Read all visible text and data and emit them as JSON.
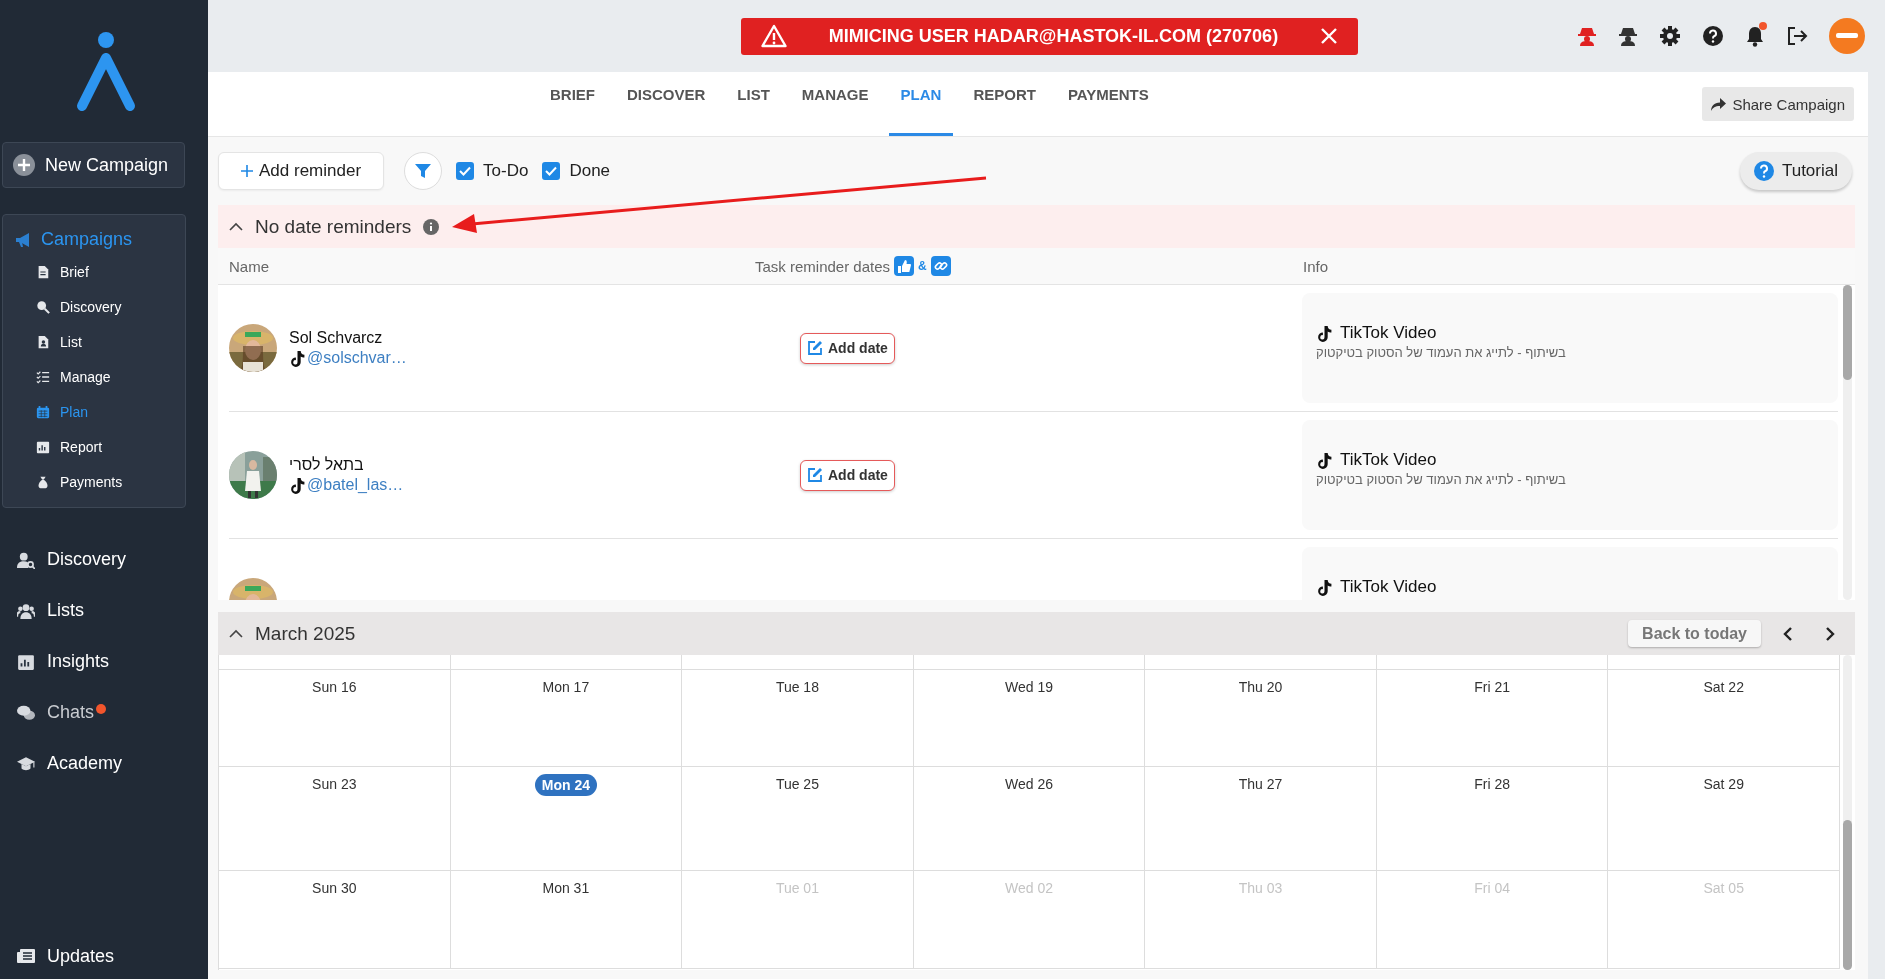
{
  "sidebar": {
    "new_campaign": "New Campaign",
    "campaigns": {
      "label": "Campaigns",
      "items": [
        {
          "label": "Brief",
          "selected": false
        },
        {
          "label": "Discovery",
          "selected": false
        },
        {
          "label": "List",
          "selected": false
        },
        {
          "label": "Manage",
          "selected": false
        },
        {
          "label": "Plan",
          "selected": true
        },
        {
          "label": "Report",
          "selected": false
        },
        {
          "label": "Payments",
          "selected": false
        }
      ]
    },
    "nav": [
      {
        "label": "Discovery",
        "unread": false
      },
      {
        "label": "Lists",
        "unread": false
      },
      {
        "label": "Insights",
        "unread": false
      },
      {
        "label": "Chats",
        "unread": true
      },
      {
        "label": "Academy",
        "unread": false
      }
    ],
    "updates": "Updates"
  },
  "banner": {
    "text": "MIMICING USER HADAR@HASTOK-IL.COM (270706)"
  },
  "tabs": [
    {
      "label": "BRIEF",
      "selected": false
    },
    {
      "label": "DISCOVER",
      "selected": false
    },
    {
      "label": "LIST",
      "selected": false
    },
    {
      "label": "MANAGE",
      "selected": false
    },
    {
      "label": "PLAN",
      "selected": true
    },
    {
      "label": "REPORT",
      "selected": false
    },
    {
      "label": "PAYMENTS",
      "selected": false
    }
  ],
  "share_button": "Share Campaign",
  "toolbar": {
    "add_reminder": "Add reminder",
    "filters": [
      {
        "label": "To-Do",
        "checked": true
      },
      {
        "label": "Done",
        "checked": true
      }
    ],
    "tutorial": "Tutorial"
  },
  "no_date_reminders": {
    "title": "No date reminders",
    "expanded": true,
    "columns": [
      "Name",
      "Task reminder dates",
      "Info"
    ],
    "amp": "&",
    "rows": [
      {
        "name": "Sol Schvarcz",
        "handle": "@solschvar…",
        "action": "Add date",
        "info_title": "TikTok Video",
        "info_text": "בשיתוף - לתייג את העמוד של הסטוק בטיקטוק"
      },
      {
        "name": "בתאל לסרי",
        "handle": "@batel_las…",
        "action": "Add date",
        "info_title": "TikTok Video",
        "info_text": "בשיתוף - לתייג את העמוד של הסטוק בטיקטוק"
      },
      {
        "info_title": "TikTok Video"
      }
    ]
  },
  "calendar": {
    "title": "March 2025",
    "expanded": true,
    "back_today": "Back to today",
    "weeks": [
      [
        {
          "label": "Sun 16",
          "selected": false,
          "outside": false
        },
        {
          "label": "Mon 17",
          "selected": false,
          "outside": false
        },
        {
          "label": "Tue 18",
          "selected": false,
          "outside": false
        },
        {
          "label": "Wed 19",
          "selected": false,
          "outside": false
        },
        {
          "label": "Thu 20",
          "selected": false,
          "outside": false
        },
        {
          "label": "Fri 21",
          "selected": false,
          "outside": false
        },
        {
          "label": "Sat 22",
          "selected": false,
          "outside": false
        }
      ],
      [
        {
          "label": "Sun 23",
          "selected": false,
          "outside": false
        },
        {
          "label": "Mon 24",
          "selected": true,
          "outside": false
        },
        {
          "label": "Tue 25",
          "selected": false,
          "outside": false
        },
        {
          "label": "Wed 26",
          "selected": false,
          "outside": false
        },
        {
          "label": "Thu 27",
          "selected": false,
          "outside": false
        },
        {
          "label": "Fri 28",
          "selected": false,
          "outside": false
        },
        {
          "label": "Sat 29",
          "selected": false,
          "outside": false
        }
      ],
      [
        {
          "label": "Sun 30",
          "selected": false,
          "outside": false
        },
        {
          "label": "Mon 31",
          "selected": false,
          "outside": false
        },
        {
          "label": "Tue 01",
          "selected": false,
          "outside": true
        },
        {
          "label": "Wed 02",
          "selected": false,
          "outside": true
        },
        {
          "label": "Thu 03",
          "selected": false,
          "outside": true
        },
        {
          "label": "Fri 04",
          "selected": false,
          "outside": true
        },
        {
          "label": "Sat 05",
          "selected": false,
          "outside": true
        }
      ]
    ]
  }
}
